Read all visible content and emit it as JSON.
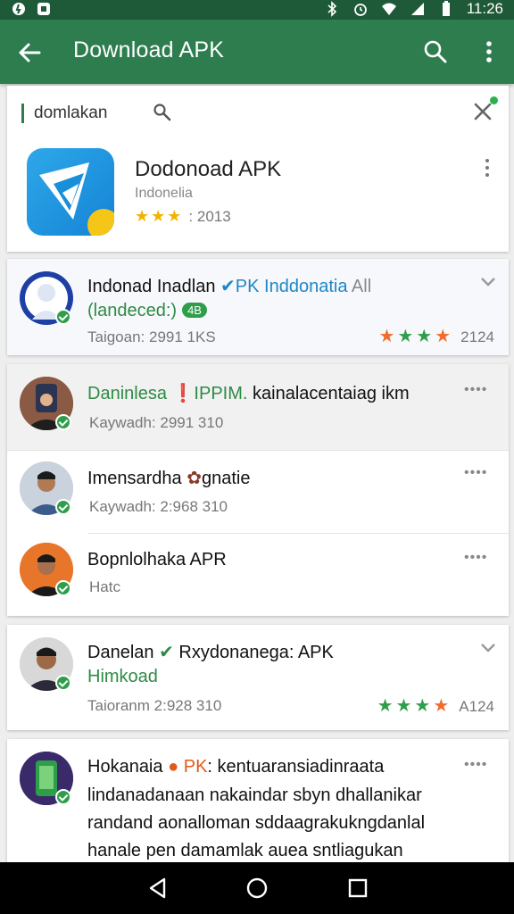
{
  "status_bar": {
    "time": "11:26"
  },
  "app_bar": {
    "title": "Download APK"
  },
  "search": {
    "query": "domlakan"
  },
  "featured": {
    "title": "Dodonoad APK",
    "subtitle": "Indonelia",
    "rating_stars": 3,
    "rating_count": "2013"
  },
  "results": [
    {
      "name": "Indonad Inadlan",
      "tag": "PK",
      "tag_rest": "Inddonatia",
      "scope": "All",
      "line2": "(landeced:)",
      "badge": "4B",
      "meta": "Taigoan: 2991 1KS",
      "stars": 4,
      "count": "2124"
    },
    {
      "name": "Daninlesa",
      "tag": "IPPIM.",
      "rest": "kainalacentaiag ikm",
      "meta": "Kaywadh: 2991 310"
    },
    {
      "name": "Imensardha",
      "rest": "gnatie",
      "meta": "Kaywadh: 2:968 310"
    },
    {
      "name": "Bopnlolhaka APR",
      "meta": "Hatc"
    },
    {
      "name": "Danelan",
      "tag": "Rxydonanega: APK",
      "line2": "Himkoad",
      "meta": "Taioranm 2:928 310",
      "stars": 4,
      "count": "A124"
    },
    {
      "name": "Hokanaia",
      "tag": "PK",
      "rest": ": kentuaransiadinraata",
      "body": [
        "lindanadanaan nakaindar sbyn dhallanikar",
        "randand aonalloman sddaagrakukngdanlal",
        "hanale pen damamlak auea sntliagukan"
      ]
    }
  ],
  "colors": {
    "app_bar": "#2e7d4f",
    "status_bar": "#1e5a38",
    "accent_green": "#2e9e4a",
    "star_gold": "#f2b300",
    "star_orange": "#f26b2b",
    "verified_blue": "#1f86c7"
  },
  "icons": {
    "back": "arrow-left-icon",
    "search": "search-icon",
    "more": "more-vert-icon",
    "clear": "close-icon",
    "nav_back": "nav-back-icon",
    "nav_home": "nav-home-icon",
    "nav_recents": "nav-recents-icon"
  }
}
